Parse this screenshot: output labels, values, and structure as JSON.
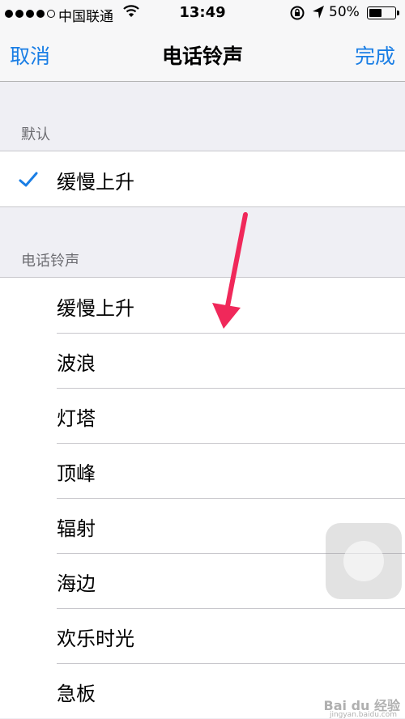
{
  "status_bar": {
    "carrier": "中国联通",
    "time": "13:49",
    "battery_percent": "50%",
    "battery_level": 0.5,
    "icons": [
      "signal-dots-icon",
      "wifi-icon",
      "rotation-lock-icon",
      "location-arrow-icon",
      "battery-icon"
    ]
  },
  "nav": {
    "cancel_label": "取消",
    "title": "电话铃声",
    "done_label": "完成"
  },
  "sections": {
    "default_header": "默认",
    "default_item": "缓慢上升",
    "ringtones_header": "电话铃声"
  },
  "ringtones": [
    "缓慢上升",
    "波浪",
    "灯塔",
    "顶峰",
    "辐射",
    "海边",
    "欢乐时光",
    "急板"
  ],
  "watermark": {
    "text": "Bai du 经验",
    "sub": "jingyan.baidu.com"
  },
  "colors": {
    "accent": "#1a7ee5",
    "annotation_arrow": "#f0285a"
  }
}
